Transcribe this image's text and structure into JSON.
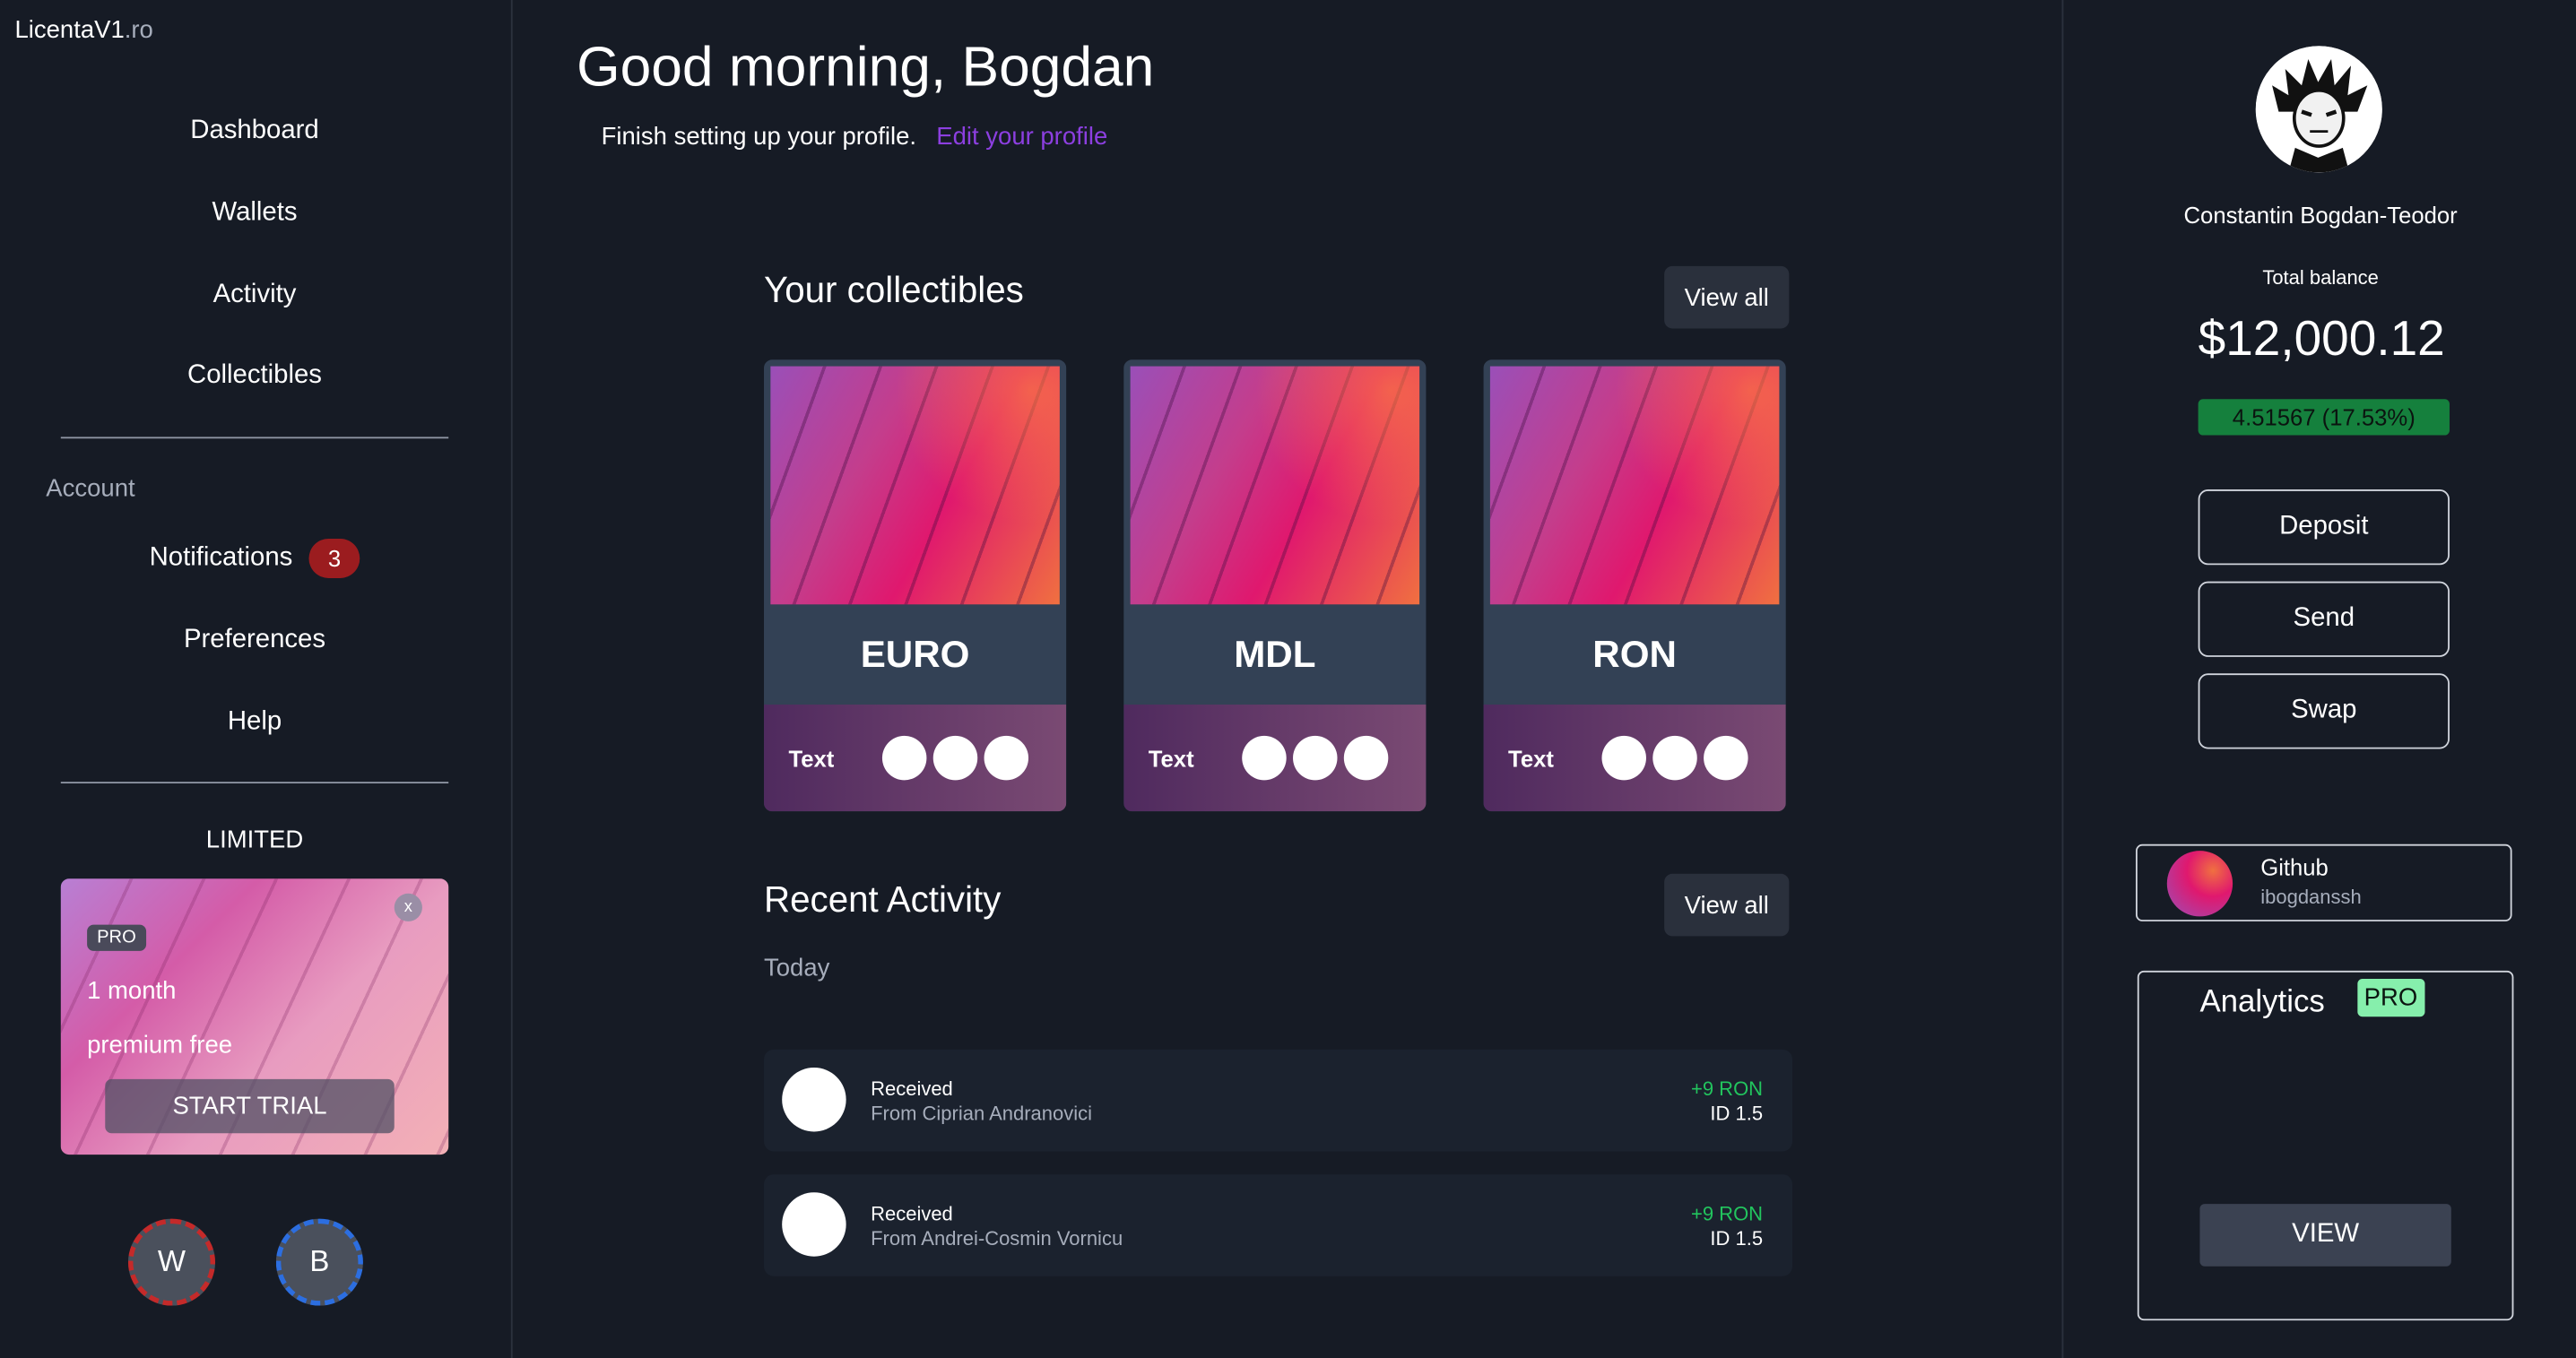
{
  "brand": {
    "name": "LicentaV1",
    "tld": ".ro"
  },
  "sidebar": {
    "nav": [
      {
        "label": "Dashboard"
      },
      {
        "label": "Wallets"
      },
      {
        "label": "Activity"
      },
      {
        "label": "Collectibles"
      }
    ],
    "account_label": "Account",
    "account_items": {
      "notifications": {
        "label": "Notifications",
        "count": "3"
      },
      "preferences": "Preferences",
      "help": "Help"
    },
    "limited_label": "LIMITED",
    "promo": {
      "close": "x",
      "tag": "PRO",
      "line1": "1 month",
      "line2": "premium free",
      "cta": "START TRIAL"
    },
    "avatars": [
      "W",
      "B"
    ]
  },
  "main": {
    "greeting": "Good morning, Bogdan",
    "subtext": "Finish setting up your profile.",
    "subtext_link": "Edit your profile",
    "collectibles": {
      "title": "Your collectibles",
      "view_all": "View all",
      "cards": [
        {
          "name": "EURO",
          "label": "Text"
        },
        {
          "name": "MDL",
          "label": "Text"
        },
        {
          "name": "RON",
          "label": "Text"
        }
      ]
    },
    "activity": {
      "title": "Recent Activity",
      "view_all": "View all",
      "group": "Today",
      "items": [
        {
          "type": "Received",
          "from": "From Ciprian Andranovici",
          "amount": "+9 RON",
          "id": "ID 1.5"
        },
        {
          "type": "Received",
          "from": "From Andrei-Cosmin Vornicu",
          "amount": "+9 RON",
          "id": "ID 1.5"
        }
      ]
    }
  },
  "right": {
    "name": "Constantin Bogdan-Teodor",
    "total_balance_label": "Total balance",
    "total_balance": "$12,000.12",
    "change": "4.51567 (17.53%)",
    "buttons": {
      "deposit": "Deposit",
      "send": "Send",
      "swap": "Swap"
    },
    "github": {
      "title": "Github",
      "handle": "ibogdanssh"
    },
    "analytics": {
      "title": "Analytics",
      "badge": "PRO",
      "view": "VIEW"
    }
  },
  "colors": {
    "background": "#161b25",
    "link": "#8c3fe0",
    "positive": "#22c55e",
    "badge": "#9b1c1f",
    "pro_badge": "#86efac"
  }
}
